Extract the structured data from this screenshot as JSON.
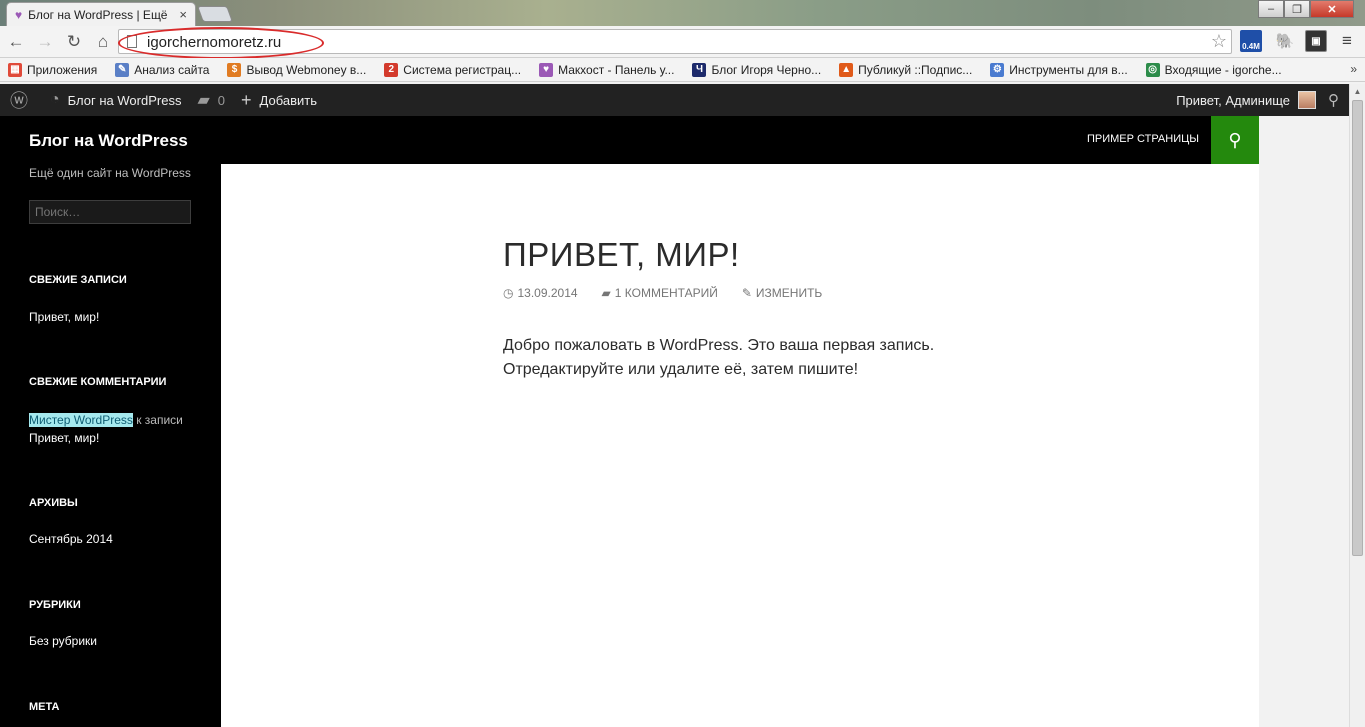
{
  "browser": {
    "tab_title": "Блог на WordPress | Ещё",
    "tab_close": "×",
    "url": "igorchernomoretz.ru",
    "ext_badge": "0.4M"
  },
  "bookmarks": [
    {
      "label": "Приложения",
      "icon": "apps-icon",
      "color": "#e04a3a",
      "glyph": "▦"
    },
    {
      "label": "Анализ сайта",
      "icon": "analysis-icon",
      "color": "#5a7fc6",
      "glyph": "✎"
    },
    {
      "label": "Вывод Webmoney в...",
      "icon": "webmoney-icon",
      "color": "#e07b22",
      "glyph": "$"
    },
    {
      "label": "Система регистрац...",
      "icon": "registration-icon",
      "color": "#d33a2c",
      "glyph": "2"
    },
    {
      "label": "Макхост - Панель у...",
      "icon": "heart-icon",
      "color": "#9b59b6",
      "glyph": "♥"
    },
    {
      "label": "Блог Игоря Черно...",
      "icon": "blog-icon",
      "color": "#1d2a6b",
      "glyph": "Ч"
    },
    {
      "label": "Публикуй ::Подпис...",
      "icon": "publish-icon",
      "color": "#e05a1a",
      "glyph": "▲"
    },
    {
      "label": "Инструменты для в...",
      "icon": "tools-icon",
      "color": "#4a7bd0",
      "glyph": "⚙"
    },
    {
      "label": "Входящие - igorche...",
      "icon": "inbox-icon",
      "color": "#2c8c4a",
      "glyph": "◎"
    }
  ],
  "bookmarks_more": "»",
  "adminbar": {
    "site_name": "Блог на WordPress",
    "comments_count": "0",
    "add_new": "Добавить",
    "greeting": "Привет, Админище"
  },
  "site": {
    "title": "Блог на WordPress",
    "description": "Ещё один сайт на WordPress",
    "search_placeholder": "Поиск…",
    "menu_item": "ПРИМЕР СТРАНИЦЫ"
  },
  "widgets": {
    "recent_posts_title": "СВЕЖИЕ ЗАПИСИ",
    "recent_post": "Привет, мир!",
    "recent_comments_title": "СВЕЖИЕ КОММЕНТАРИИ",
    "comment_author": "Мистер WordPress",
    "comment_on": " к записи",
    "comment_post": "Привет, мир!",
    "archives_title": "АРХИВЫ",
    "archive_item": "Сентябрь 2014",
    "categories_title": "РУБРИКИ",
    "category_item": "Без рубрики",
    "meta_title": "МЕТА"
  },
  "post": {
    "title": "ПРИВЕТ, МИР!",
    "date": "13.09.2014",
    "comments": "1 КОММЕНТАРИЙ",
    "edit": "ИЗМЕНИТЬ",
    "content": "Добро пожаловать в WordPress. Это ваша первая запись. Отредактируйте или удалите её, затем пишите!"
  }
}
